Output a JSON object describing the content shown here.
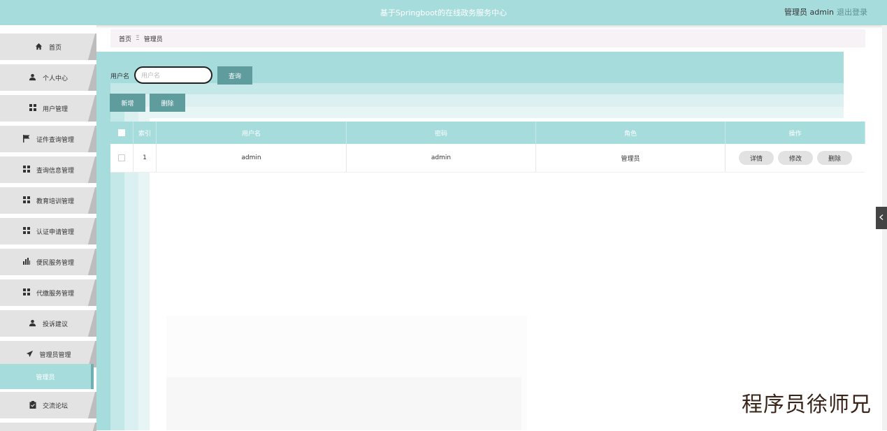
{
  "header": {
    "title": "基于Springboot的在线政务服务中心",
    "user_label": "管理员 admin",
    "logout": "退出登录"
  },
  "sidebar": {
    "items": [
      {
        "label": "首页",
        "icon": "home-icon"
      },
      {
        "label": "个人中心",
        "icon": "user-icon"
      },
      {
        "label": "用户管理",
        "icon": "grid-icon"
      },
      {
        "label": "证件查询管理",
        "icon": "flag-icon"
      },
      {
        "label": "查询信息管理",
        "icon": "grid-icon"
      },
      {
        "label": "教育培训管理",
        "icon": "grid-icon"
      },
      {
        "label": "认证申请管理",
        "icon": "grid-icon"
      },
      {
        "label": "便民服务管理",
        "icon": "bar-chart-icon"
      },
      {
        "label": "代缴服务管理",
        "icon": "grid-icon"
      },
      {
        "label": "投诉建议",
        "icon": "user-icon"
      },
      {
        "label": "管理员管理",
        "icon": "send-icon"
      },
      {
        "label": "交流论坛",
        "icon": "clipboard-icon"
      }
    ],
    "active_sub": "管理员"
  },
  "breadcrumb": {
    "home": "首页",
    "separator": "Ξ",
    "current": "管理员"
  },
  "search": {
    "label": "用户名",
    "placeholder": "用户名",
    "query_button": "查询"
  },
  "actions": {
    "add": "新增",
    "delete": "删除"
  },
  "table": {
    "columns": [
      "索引",
      "用户名",
      "密码",
      "角色",
      "操作"
    ],
    "rows": [
      {
        "index": "1",
        "username": "admin",
        "password": "admin",
        "role": "管理员"
      }
    ],
    "row_actions": {
      "detail": "详情",
      "edit": "修改",
      "delete": "删除"
    }
  },
  "watermark": "程序员徐师兄",
  "colors": {
    "accent": "#a7dcdd",
    "button": "#5e9c9e"
  }
}
